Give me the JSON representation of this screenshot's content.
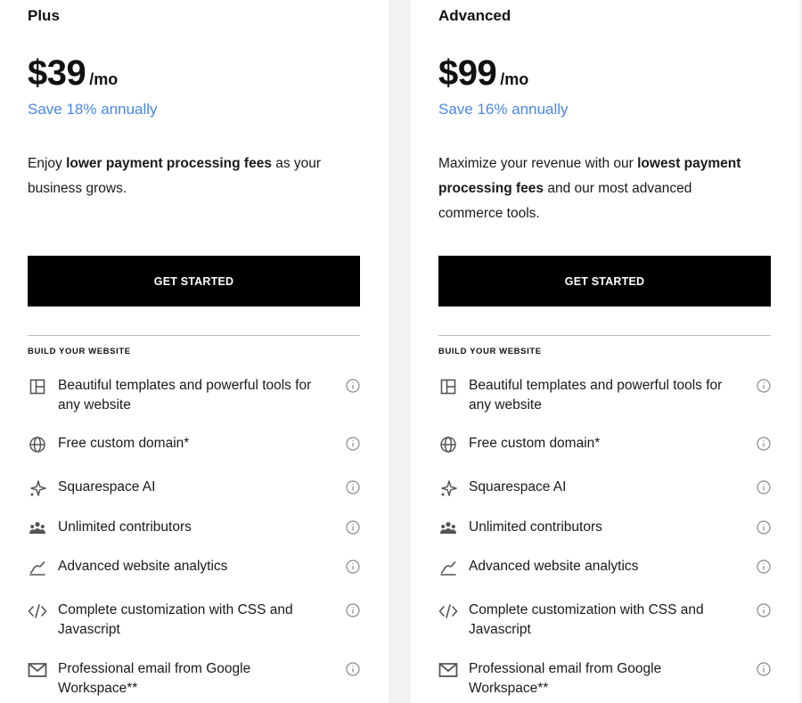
{
  "plans": [
    {
      "name": "Plus",
      "price": "$39",
      "period": "/mo",
      "save": "Save 18% annually",
      "desc_parts": [
        "Enjoy ",
        "lower payment processing fees",
        " as your business grows."
      ],
      "cta": "GET STARTED",
      "section_title": "BUILD YOUR WEBSITE"
    },
    {
      "name": "Advanced",
      "price": "$99",
      "period": "/mo",
      "save": "Save 16% annually",
      "desc_parts": [
        "Maximize your revenue with our ",
        "lowest payment processing fees",
        " and our most advanced commerce tools."
      ],
      "cta": "GET STARTED",
      "section_title": "BUILD YOUR WEBSITE"
    }
  ],
  "features": [
    {
      "label": "Beautiful templates and powerful tools for any website",
      "icon": "layout-icon"
    },
    {
      "label": "Free custom domain*",
      "icon": "globe-icon"
    },
    {
      "label": "Squarespace AI",
      "icon": "sparkle-icon"
    },
    {
      "label": "Unlimited contributors",
      "icon": "people-icon"
    },
    {
      "label": "Advanced website analytics",
      "icon": "analytics-icon"
    },
    {
      "label": "Complete customization with CSS and Javascript",
      "icon": "code-icon"
    },
    {
      "label": "Professional email from Google Workspace**",
      "icon": "mail-icon"
    }
  ],
  "colors": {
    "accent": "#4a86e8",
    "button_bg": "#000000",
    "icon": "#555555"
  }
}
